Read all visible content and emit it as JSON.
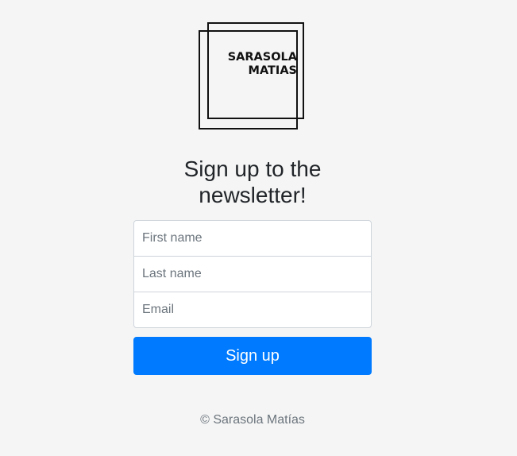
{
  "logo": {
    "line1": "SARASOLA",
    "line2": "MATIAS"
  },
  "heading": "Sign up to the newsletter!",
  "form": {
    "first_name_placeholder": "First name",
    "first_name_value": "",
    "last_name_placeholder": "Last name",
    "last_name_value": "",
    "email_placeholder": "Email",
    "email_value": "",
    "submit_label": "Sign up"
  },
  "footer": {
    "copyright": "© Sarasola Matías"
  },
  "colors": {
    "background": "#f5f5f5",
    "primary": "#007bff",
    "text": "#212529",
    "muted": "#6c757d"
  }
}
